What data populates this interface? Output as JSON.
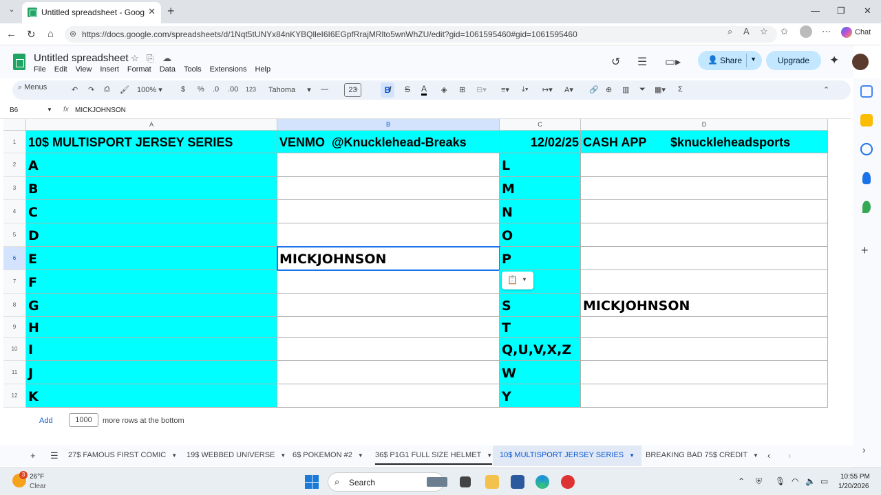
{
  "browser": {
    "tab_title": "Untitled spreadsheet - Google She",
    "url": "https://docs.google.com/spreadsheets/d/1Nqt5tUNYx84nKYBQlleI6I6EGpfRrajMRlto5wnWhZU/edit?gid=1061595460#gid=1061595460",
    "chat_label": "Chat"
  },
  "sheets": {
    "doc_title": "Untitled spreadsheet",
    "menu": [
      "File",
      "Edit",
      "View",
      "Insert",
      "Format",
      "Data",
      "Tools",
      "Extensions",
      "Help"
    ],
    "share_label": "Share",
    "upgrade_label": "Upgrade"
  },
  "toolbar": {
    "menus_label": "Menus",
    "zoom": "100%",
    "currency": "$",
    "percent": "%",
    "dec_decrease": ".0",
    "dec_increase": ".00",
    "number_format": "123",
    "font": "Tahoma",
    "font_size": "23",
    "bold": "B",
    "italic": "I",
    "strikethrough": "S",
    "text_color": "A"
  },
  "formula_bar": {
    "name_box": "B6",
    "value": "MICKJOHNSON"
  },
  "grid": {
    "columns": [
      "A",
      "B",
      "C",
      "D"
    ],
    "selected_column": "B",
    "rows": [
      "1",
      "2",
      "3",
      "4",
      "5",
      "6",
      "7",
      "8",
      "9",
      "10",
      "11",
      "12"
    ],
    "selected_row": "6",
    "cells": {
      "A1": "10$ MULTISPORT JERSEY SERIES",
      "B1": "VENMO  @Knucklehead-Breaks",
      "C1": "12/02/25",
      "D1": "CASH APP       $knuckleheadsports",
      "A2": "A",
      "A3": "B",
      "A4": "C",
      "A5": "D",
      "A6": "E",
      "A7": "F",
      "A8": "G",
      "A9": "H",
      "A10": "I",
      "A11": "J",
      "A12": "K",
      "B6": "MICKJOHNSON",
      "C2": "L",
      "C3": "M",
      "C4": "N",
      "C5": "O",
      "C6": "P",
      "C7": "",
      "C8": "S",
      "C9": "T",
      "C10": "Q,U,V,X,Z",
      "C11": "W",
      "C12": "Y",
      "D8": "MICKJOHNSON"
    },
    "fill_color": "#00ffff"
  },
  "add_rows": {
    "button": "Add",
    "count": "1000",
    "suffix": "more rows at the bottom"
  },
  "sheet_tabs": [
    "27$ FAMOUS FIRST COMIC",
    "19$ WEBBED UNIVERSE",
    "6$ POKEMON #2",
    "36$ P1G1 FULL SIZE HELMET",
    "10$ MULTISPORT JERSEY SERIES",
    "BREAKING BAD 75$ CREDIT"
  ],
  "active_sheet": "10$ MULTISPORT JERSEY SERIES",
  "taskbar": {
    "weather_temp": "26°F",
    "weather_status": "Clear",
    "weather_badge": "3",
    "search_label": "Search",
    "time": "10:55 PM",
    "date": "1/20/2026"
  }
}
